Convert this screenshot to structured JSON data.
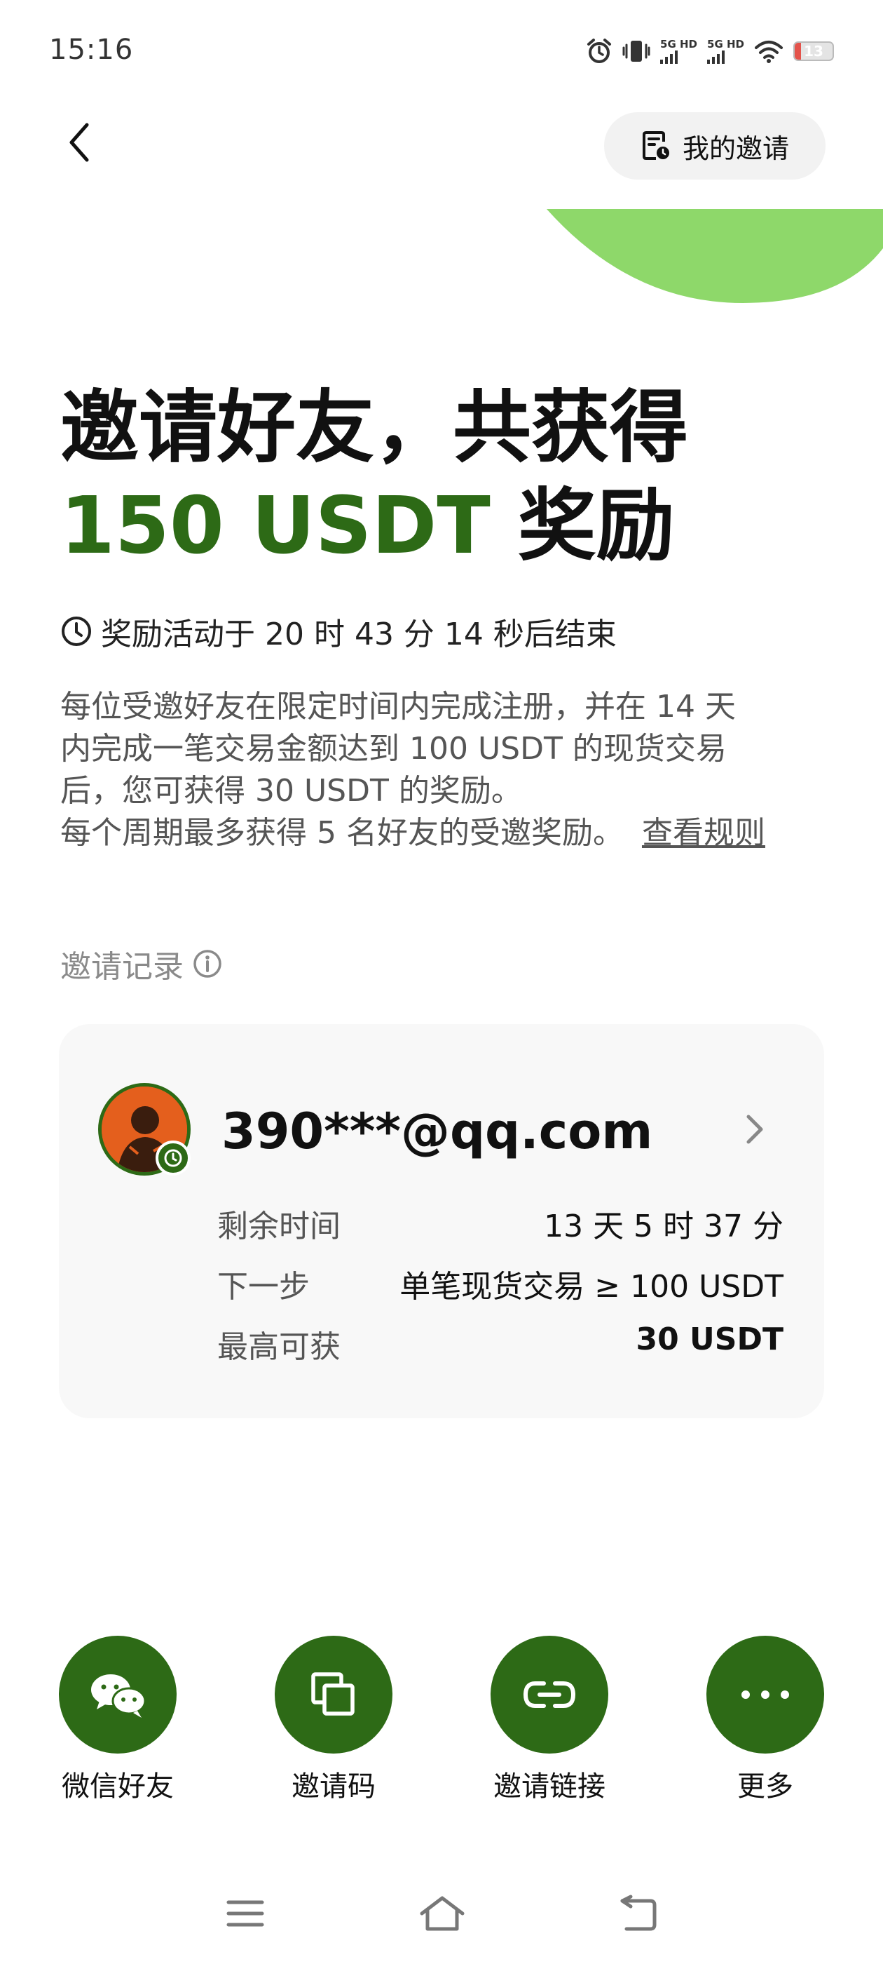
{
  "status_bar": {
    "time": "15:16",
    "signal_1": "5G HD",
    "signal_2": "5G HD",
    "battery": "13"
  },
  "header": {
    "my_invites_label": "我的邀请"
  },
  "hero": {
    "line1": "邀请好友，共获得",
    "amount": "150 USDT",
    "line2_suffix": "奖励"
  },
  "countdown": "奖励活动于 20 时 43 分 14 秒后结束",
  "description": {
    "line1": "每位受邀好友在限定时间内完成注册，并在 14 天",
    "line2": "内完成一笔交易金额达到 100 USDT 的现货交易",
    "line3": "后，您可获得 30 USDT 的奖励。",
    "line4": "每个周期最多获得 5 名好友的受邀奖励。",
    "rules_link": "查看规则"
  },
  "records": {
    "title": "邀请记录",
    "items": [
      {
        "email": "390***@qq.com",
        "remaining_label": "剩余时间",
        "remaining_value": "13 天 5 时 37 分",
        "next_label": "下一步",
        "next_value": "单笔现货交易 ≥ 100 USDT",
        "max_label": "最高可获",
        "max_value": "30 USDT"
      }
    ]
  },
  "share": [
    {
      "label": "微信好友",
      "icon": "wechat-icon"
    },
    {
      "label": "邀请码",
      "icon": "copy-icon"
    },
    {
      "label": "邀请链接",
      "icon": "link-icon"
    },
    {
      "label": "更多",
      "icon": "more-icon"
    }
  ],
  "colors": {
    "accent": "#2d6a16",
    "blob": "#8ed86a",
    "card_bg": "#f8f8f8"
  }
}
